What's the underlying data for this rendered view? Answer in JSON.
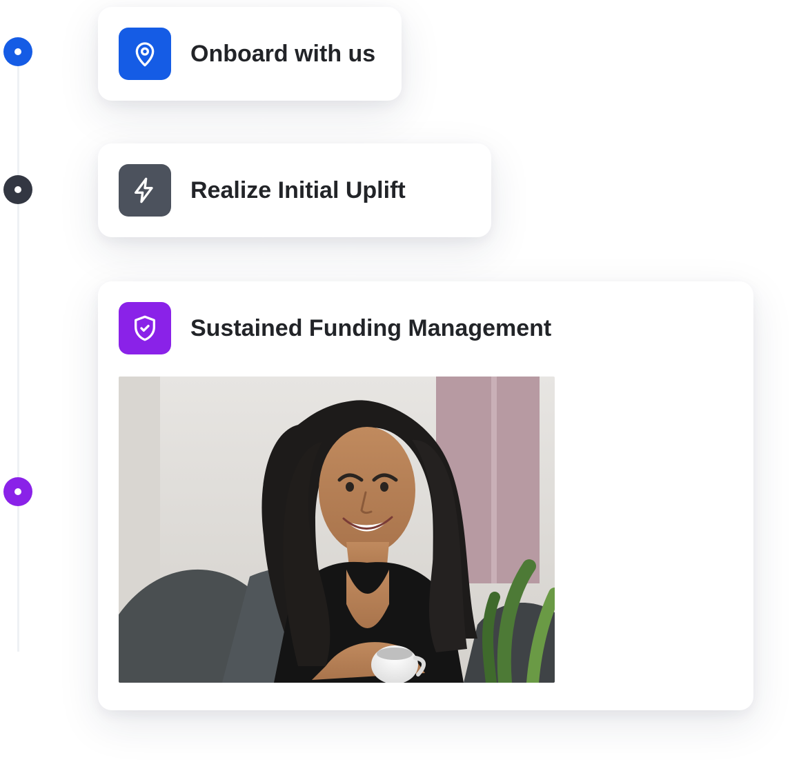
{
  "steps": [
    {
      "title": "Onboard with us",
      "dot_color": "#155ce5",
      "tile_color": "#155ce5",
      "icon": "pin"
    },
    {
      "title": "Realize Initial Uplift",
      "dot_color": "#333742",
      "tile_color": "#4c525d",
      "icon": "bolt"
    },
    {
      "title": "Sustained Funding Management",
      "dot_color": "#8a22e8",
      "tile_color": "#8a22e8",
      "icon": "shield"
    }
  ]
}
